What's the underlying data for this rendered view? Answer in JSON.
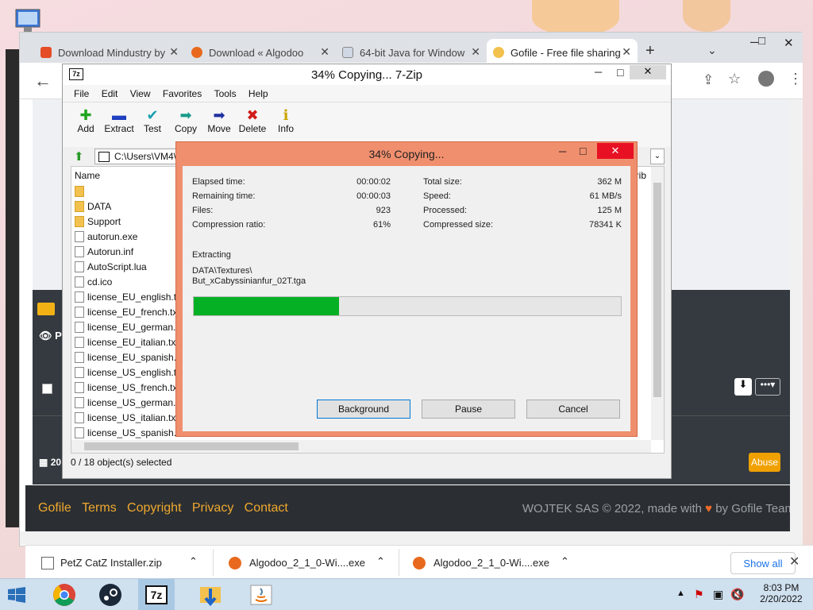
{
  "browser": {
    "tabs": [
      {
        "label": "Download Mindustry by"
      },
      {
        "label": "Download « Algodoo"
      },
      {
        "label": "64-bit Java for Window"
      },
      {
        "label": "Gofile - Free file sharing"
      }
    ]
  },
  "zip_window": {
    "title": "34% Copying... 7-Zip",
    "logo": "7z",
    "menu": [
      "File",
      "Edit",
      "View",
      "Favorites",
      "Tools",
      "Help"
    ],
    "tools": [
      {
        "label": "Add",
        "glyph": "✚",
        "color": "#1fa51f"
      },
      {
        "label": "Extract",
        "glyph": "▬",
        "color": "#1e3fbf"
      },
      {
        "label": "Test",
        "glyph": "✔",
        "color": "#1aa0b0"
      },
      {
        "label": "Copy",
        "glyph": "➡",
        "color": "#1a9a8a"
      },
      {
        "label": "Move",
        "glyph": "➡",
        "color": "#1e2f9f"
      },
      {
        "label": "Delete",
        "glyph": "✖",
        "color": "#d11a1a"
      },
      {
        "label": "Info",
        "glyph": "ℹ",
        "color": "#c9a400"
      }
    ],
    "path": "C:\\Users\\VM4\\",
    "list_header": {
      "name": "Name",
      "attrib": "Attrib"
    },
    "items": [
      {
        "name": "",
        "type": "folder"
      },
      {
        "name": "DATA",
        "type": "folder"
      },
      {
        "name": "Support",
        "type": "folder"
      },
      {
        "name": "autorun.exe",
        "type": "file"
      },
      {
        "name": "Autorun.inf",
        "type": "file"
      },
      {
        "name": "AutoScript.lua",
        "type": "file"
      },
      {
        "name": "cd.ico",
        "type": "file"
      },
      {
        "name": "license_EU_english.txt",
        "type": "file"
      },
      {
        "name": "license_EU_french.txt",
        "type": "file"
      },
      {
        "name": "license_EU_german.txt",
        "type": "file"
      },
      {
        "name": "license_EU_italian.txt",
        "type": "file"
      },
      {
        "name": "license_EU_spanish.txt",
        "type": "file"
      },
      {
        "name": "license_US_english.txt",
        "type": "file"
      },
      {
        "name": "license_US_french.txt",
        "type": "file"
      },
      {
        "name": "license_US_german.txt",
        "type": "file"
      },
      {
        "name": "license_US_italian.txt",
        "type": "file"
      },
      {
        "name": "license_US_spanish.txt",
        "type": "file"
      }
    ],
    "status": "0 / 18 object(s) selected"
  },
  "copy_dialog": {
    "title": "34% Copying...",
    "stats_left": [
      {
        "label": "Elapsed time:",
        "value": "00:00:02"
      },
      {
        "label": "Remaining time:",
        "value": "00:00:03"
      },
      {
        "label": "Files:",
        "value": "923"
      },
      {
        "label": "Compression ratio:",
        "value": "61%"
      }
    ],
    "stats_right": [
      {
        "label": "Total size:",
        "value": "362 M"
      },
      {
        "label": "Speed:",
        "value": "61 MB/s"
      },
      {
        "label": "Processed:",
        "value": "125 M"
      },
      {
        "label": "Compressed size:",
        "value": "78341 K"
      }
    ],
    "operation": "Extracting",
    "current_path": "DATA\\Textures\\",
    "current_file": "But_xCabyssinianfur_02T.tga",
    "progress_percent": 34,
    "progress_color": "#06b025",
    "buttons": {
      "background": "Background",
      "pause": "Pause",
      "cancel": "Cancel"
    }
  },
  "site": {
    "side_text": "Pu",
    "date_stub": "20",
    "abuse": "Abuse",
    "footer_links": [
      "Gofile",
      "Terms",
      "Copyright",
      "Privacy",
      "Contact"
    ],
    "footer_right_1": "WOJTEK SAS © 2022, made with",
    "footer_heart": "♥",
    "footer_right_2": "by Gofile Team",
    "accent": "#f0a82e"
  },
  "downloads": {
    "items": [
      "PetZ CatZ Installer.zip",
      "Algodoo_2_1_0-Wi....exe",
      "Algodoo_2_1_0-Wi....exe"
    ],
    "show_all": "Show all"
  },
  "taskbar": {
    "time": "8:03 PM",
    "date": "2/20/2022"
  }
}
